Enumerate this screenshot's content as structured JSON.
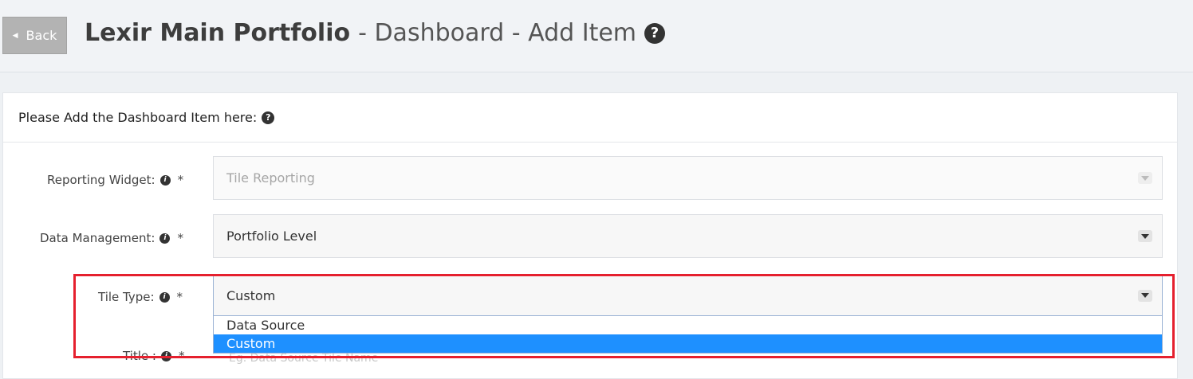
{
  "header": {
    "back_label": "Back",
    "title_bold": "Lexir Main Portfolio",
    "title_rest": "- Dashboard - Add Item",
    "help_icon": "question-circle-icon"
  },
  "panel": {
    "heading": "Please Add the Dashboard Item here:"
  },
  "form": {
    "reporting_widget": {
      "label": "Reporting Widget:",
      "required": "*",
      "value": "Tile Reporting"
    },
    "data_management": {
      "label": "Data Management:",
      "required": "*",
      "value": "Portfolio Level"
    },
    "tile_type": {
      "label": "Tile Type:",
      "required": "*",
      "value": "Custom",
      "options": [
        "Data Source",
        "Custom"
      ],
      "selected_option": "Custom"
    },
    "title": {
      "label": "Title :",
      "required": "*",
      "placeholder_partial": "Eg. Data Source Tile Name"
    }
  },
  "colors": {
    "highlight": "#e5202e",
    "selected_option": "#1e90ff"
  }
}
